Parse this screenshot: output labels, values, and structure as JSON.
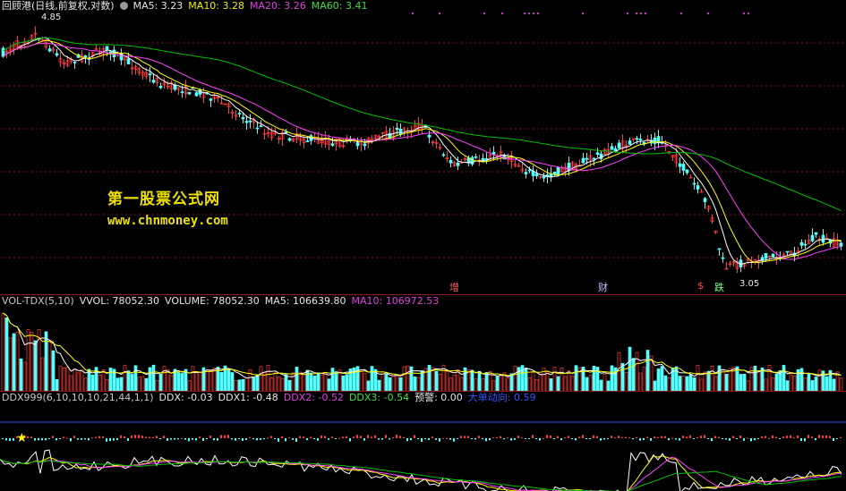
{
  "price": {
    "title": "回顾港(日线,前复权,对数)",
    "ma5_label": "MA5: 3.23",
    "ma10_label": "MA10: 3.28",
    "ma20_label": "MA20: 3.26",
    "ma60_label": "MA60: 3.41",
    "high_label": "4.85",
    "low_label": "3.05",
    "watermark_title": "第一股票公式网",
    "watermark_url": "www.chnmoney.com",
    "markers": [
      "增",
      "财",
      "$",
      "跌"
    ]
  },
  "volume": {
    "title": "VOL-TDX(5,10)",
    "vvol": "VVOL: 78052.30",
    "volume": "VOLUME: 78052.30",
    "ma5": "MA5: 106639.80",
    "ma10": "MA10: 106972.53"
  },
  "ddx": {
    "title": "DDX999(6,10,10,10,21,44,1,1)",
    "ddx": "DDX: -0.03",
    "ddx1": "DDX1: -0.48",
    "ddx2": "DDX2: -0.52",
    "ddx3": "DDX3: -0.54",
    "warn": "预警: 0.00",
    "bigbuy": "大单动向: 0.59"
  },
  "colors": {
    "up": "#ff3c3c",
    "down": "#54ffff",
    "ma5": "#ffffff",
    "ma10": "#ffff00",
    "ma20": "#ff40ff",
    "ma60": "#00c000"
  }
}
